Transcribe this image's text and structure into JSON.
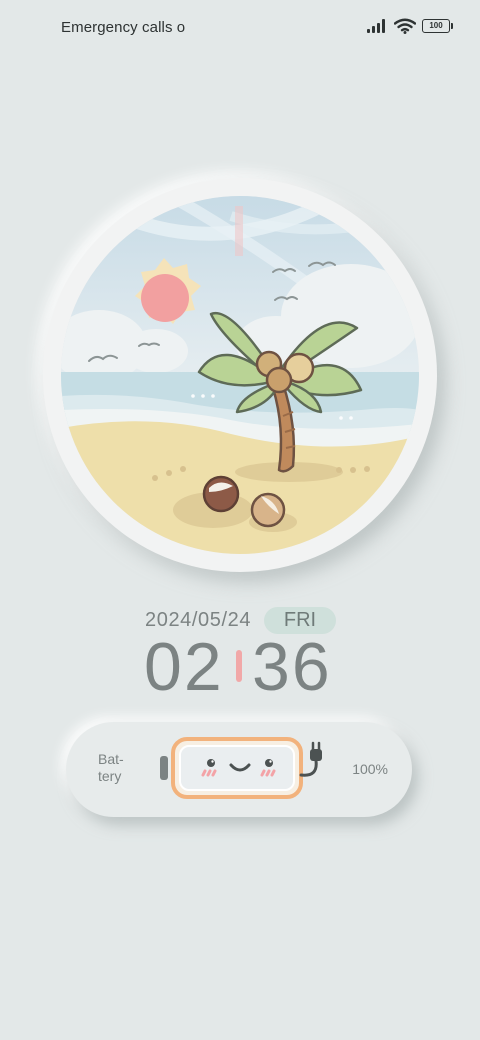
{
  "status_bar": {
    "carrier_text": "Emergency calls o",
    "battery_level": "100",
    "icons": [
      "signal-icon",
      "wifi-icon",
      "battery-icon"
    ]
  },
  "wallpaper": {
    "scene": "beach-palm-tree-illustration"
  },
  "clock": {
    "date": "2024/05/24",
    "weekday": "FRI",
    "hours": "02",
    "minutes": "36"
  },
  "battery_widget": {
    "label": "Bat-\ntery",
    "percent_text": "100%",
    "level": 1.0,
    "accent_color": "#f2b27c"
  },
  "colors": {
    "background": "#e3e8e8",
    "text": "#7c8383",
    "weekday_pill": "#cfe0db",
    "time_separator": "#f1a8a8"
  }
}
